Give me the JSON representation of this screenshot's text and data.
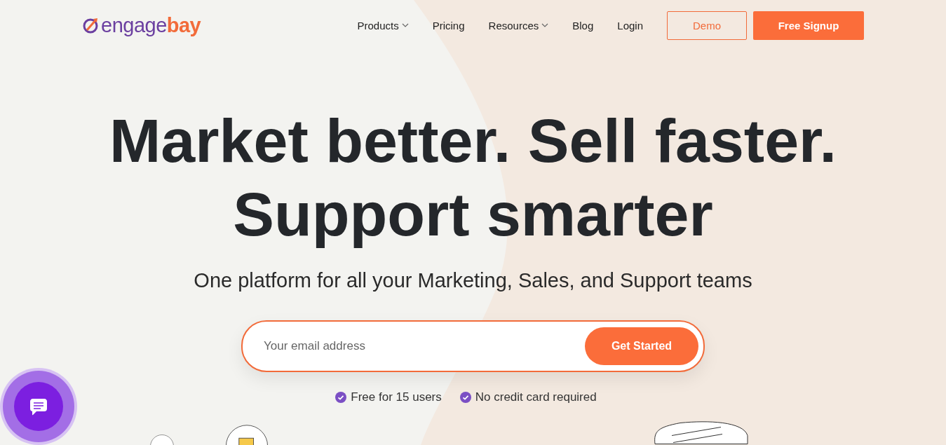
{
  "logo": {
    "primary": "engage",
    "accent": "bay"
  },
  "nav": [
    {
      "label": "Products",
      "dropdown": true
    },
    {
      "label": "Pricing",
      "dropdown": false
    },
    {
      "label": "Resources",
      "dropdown": true
    },
    {
      "label": "Blog",
      "dropdown": false
    },
    {
      "label": "Login",
      "dropdown": false
    }
  ],
  "demo_button": "Demo",
  "signup_button": "Free Signup",
  "headline": [
    "Market better. Sell faster.",
    "Support smarter"
  ],
  "subtitle": "One platform for all your Marketing, Sales, and Support teams",
  "email": {
    "placeholder": "Your email address",
    "button": "Get Started"
  },
  "perks": [
    "Free for 15 users",
    "No credit card required"
  ]
}
